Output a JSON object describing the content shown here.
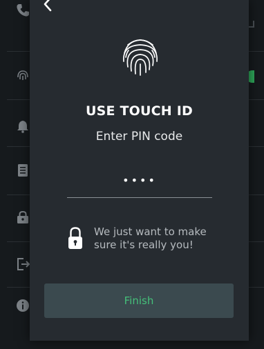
{
  "modal": {
    "title": "USE TOUCH ID",
    "subtitle": "Enter PIN code",
    "pin_value": "••••",
    "note": "We just want to make sure it's really you!",
    "finish_label": "Finish"
  },
  "icons": {
    "back": "chevron-left-icon",
    "fingerprint": "fingerprint-icon",
    "lock": "lock-icon"
  },
  "colors": {
    "modal_bg": "#262b30",
    "button_bg": "#3b4a4f",
    "button_text": "#45c07a",
    "background": "#161a1d"
  }
}
